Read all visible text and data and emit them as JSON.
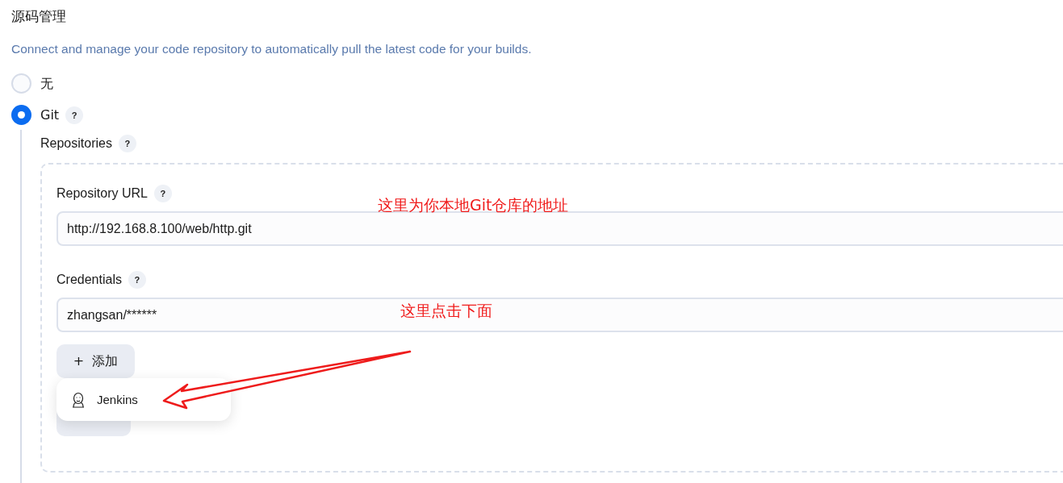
{
  "section": {
    "title": "源码管理",
    "description": "Connect and manage your code repository to automatically pull the latest code for your builds."
  },
  "scm_options": [
    {
      "label": "无",
      "selected": false
    },
    {
      "label": "Git",
      "selected": true,
      "help": "?"
    }
  ],
  "repositories": {
    "label": "Repositories",
    "help": "?",
    "url": {
      "label": "Repository URL",
      "help": "?",
      "value": "http://192.168.8.100/web/http.git"
    },
    "credentials": {
      "label": "Credentials",
      "help": "?",
      "value": "zhangsan/******"
    },
    "add_button": {
      "icon": "+",
      "label": "添加"
    },
    "add_menu": [
      {
        "label": "Jenkins"
      }
    ]
  },
  "annotations": [
    {
      "text": "这里为你本地Git仓库的地址"
    },
    {
      "text": "这里点击下面"
    }
  ]
}
